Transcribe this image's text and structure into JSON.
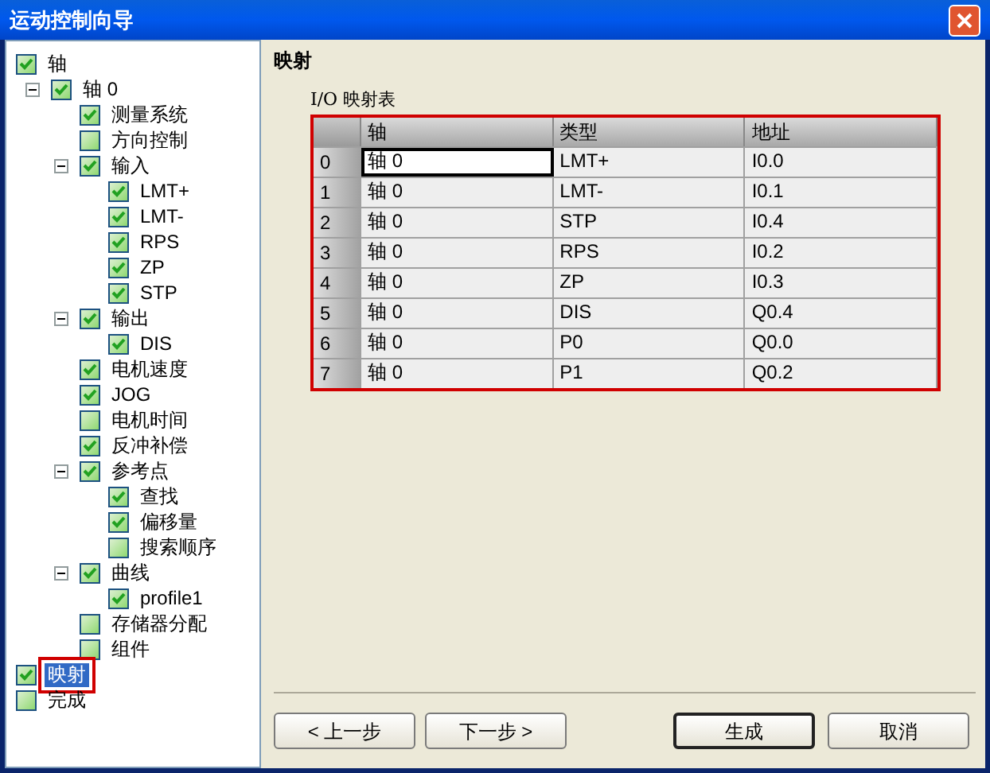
{
  "window": {
    "title": "运动控制向导"
  },
  "tree": [
    {
      "label": "轴",
      "checked": true,
      "selected": false,
      "children": [
        {
          "label": "轴 0",
          "checked": true,
          "selected": false,
          "expanded": true,
          "children": [
            {
              "label": "测量系统",
              "checked": true,
              "selected": false
            },
            {
              "label": "方向控制",
              "checked": false,
              "selected": false
            },
            {
              "label": "输入",
              "checked": true,
              "selected": false,
              "expanded": true,
              "children": [
                {
                  "label": "LMT+",
                  "checked": true,
                  "selected": false
                },
                {
                  "label": "LMT-",
                  "checked": true,
                  "selected": false
                },
                {
                  "label": "RPS",
                  "checked": true,
                  "selected": false
                },
                {
                  "label": "ZP",
                  "checked": true,
                  "selected": false
                },
                {
                  "label": "STP",
                  "checked": true,
                  "selected": false
                }
              ]
            },
            {
              "label": "输出",
              "checked": true,
              "selected": false,
              "expanded": true,
              "children": [
                {
                  "label": "DIS",
                  "checked": true,
                  "selected": false
                }
              ]
            },
            {
              "label": "电机速度",
              "checked": true,
              "selected": false
            },
            {
              "label": "JOG",
              "checked": true,
              "selected": false
            },
            {
              "label": "电机时间",
              "checked": false,
              "selected": false
            },
            {
              "label": "反冲补偿",
              "checked": true,
              "selected": false
            },
            {
              "label": "参考点",
              "checked": true,
              "selected": false,
              "expanded": true,
              "children": [
                {
                  "label": "查找",
                  "checked": true,
                  "selected": false
                },
                {
                  "label": "偏移量",
                  "checked": true,
                  "selected": false
                },
                {
                  "label": "搜索顺序",
                  "checked": false,
                  "selected": false
                }
              ]
            },
            {
              "label": "曲线",
              "checked": true,
              "selected": false,
              "expanded": true,
              "children": [
                {
                  "label": "profile1",
                  "checked": true,
                  "selected": false
                }
              ]
            },
            {
              "label": "存储器分配",
              "checked": false,
              "selected": false
            },
            {
              "label": "组件",
              "checked": false,
              "selected": false
            }
          ]
        }
      ]
    },
    {
      "label": "映射",
      "checked": true,
      "selected": true
    },
    {
      "label": "完成",
      "checked": false,
      "selected": false
    }
  ],
  "page": {
    "heading": "映射",
    "table_title": "I/O 映射表",
    "table": {
      "columns": [
        "轴",
        "类型",
        "地址"
      ],
      "rows": [
        {
          "index": "0",
          "cells": [
            "轴 0",
            "LMT+",
            "I0.0"
          ],
          "focused": true
        },
        {
          "index": "1",
          "cells": [
            "轴 0",
            "LMT-",
            "I0.1"
          ],
          "focused": false
        },
        {
          "index": "2",
          "cells": [
            "轴 0",
            "STP",
            "I0.4"
          ],
          "focused": false
        },
        {
          "index": "3",
          "cells": [
            "轴 0",
            "RPS",
            "I0.2"
          ],
          "focused": false
        },
        {
          "index": "4",
          "cells": [
            "轴 0",
            "ZP",
            "I0.3"
          ],
          "focused": false
        },
        {
          "index": "5",
          "cells": [
            "轴 0",
            "DIS",
            "Q0.4"
          ],
          "focused": false
        },
        {
          "index": "6",
          "cells": [
            "轴 0",
            "P0",
            "Q0.0"
          ],
          "focused": false
        },
        {
          "index": "7",
          "cells": [
            "轴 0",
            "P1",
            "Q0.2"
          ],
          "focused": false
        }
      ]
    }
  },
  "buttons": [
    {
      "label": "< 上一步",
      "default": false
    },
    {
      "label": "下一步 >",
      "default": false
    },
    {
      "label": "生成",
      "default": true
    },
    {
      "label": "取消",
      "default": false
    }
  ]
}
